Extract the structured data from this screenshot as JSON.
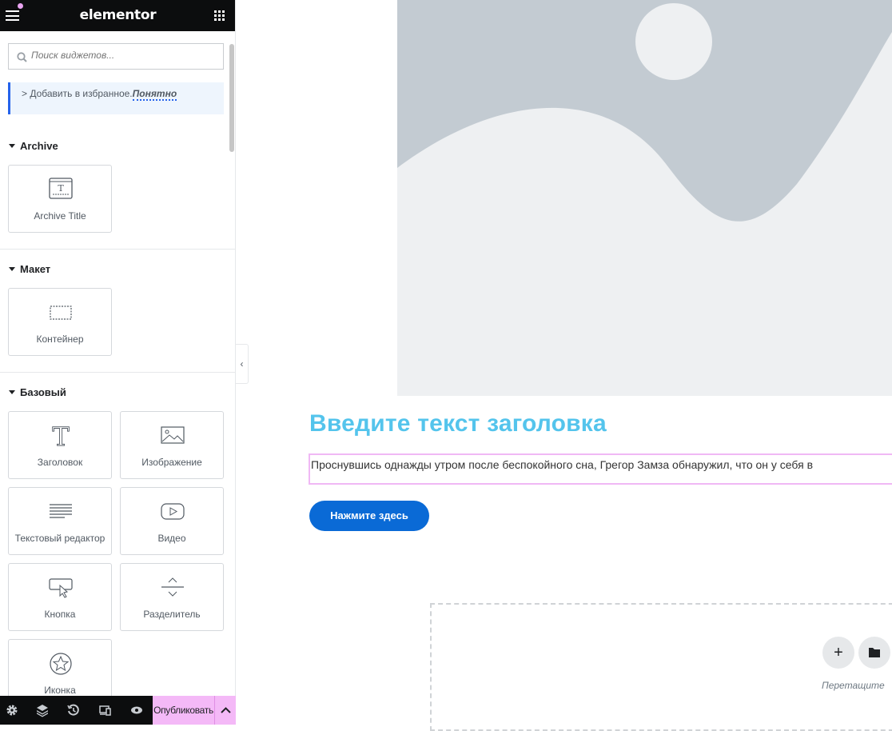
{
  "app": {
    "logo": "elementor"
  },
  "search": {
    "placeholder": "Поиск виджетов..."
  },
  "notice": {
    "text": "> Добавить в избранное.",
    "dismiss": "Понятно"
  },
  "sections": [
    {
      "title": "Archive",
      "widgets": [
        {
          "label": "Archive Title",
          "icon": "archive-title-icon"
        }
      ]
    },
    {
      "title": "Макет",
      "widgets": [
        {
          "label": "Контейнер",
          "icon": "container-icon"
        }
      ]
    },
    {
      "title": "Базовый",
      "widgets": [
        {
          "label": "Заголовок",
          "icon": "heading-icon"
        },
        {
          "label": "Изображение",
          "icon": "image-icon"
        },
        {
          "label": "Текстовый редактор",
          "icon": "text-editor-icon"
        },
        {
          "label": "Видео",
          "icon": "video-icon"
        },
        {
          "label": "Кнопка",
          "icon": "button-icon"
        },
        {
          "label": "Разделитель",
          "icon": "divider-icon"
        },
        {
          "label": "Иконка",
          "icon": "star-icon"
        }
      ]
    }
  ],
  "footer": {
    "publish": "Опубликовать"
  },
  "canvas": {
    "heading": "Введите текст заголовка",
    "text": "Проснувшись однажды утром после беспокойного сна, Грегор Замза обнаружил, что он у себя в",
    "button": "Нажмите здесь",
    "drop_text": "Перетащите"
  },
  "colors": {
    "accent": "#54c4ec",
    "button": "#0a6ad6",
    "publish": "#f4b9f7",
    "notification": "#e9a3f0"
  }
}
